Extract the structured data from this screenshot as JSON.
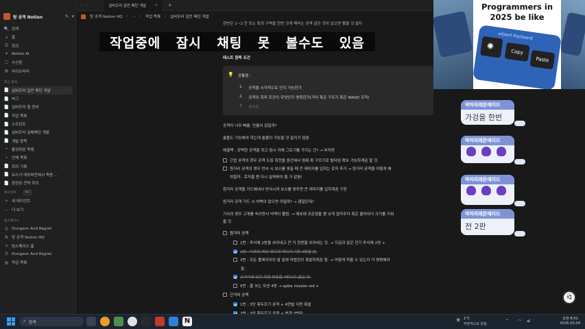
{
  "sidebar": {
    "workspace": "탕 공격 Notion",
    "nav": [
      {
        "icon": "🔍",
        "label": "검색"
      },
      {
        "icon": "⌂",
        "label": "홈"
      },
      {
        "icon": "☰",
        "label": "회의"
      },
      {
        "icon": "✦",
        "label": "Notion AI"
      },
      {
        "icon": "☐",
        "label": "수신함"
      },
      {
        "icon": "▤",
        "label": "라이브러리"
      }
    ],
    "recent_label": "최근 항목",
    "recent": [
      {
        "icon": "📄",
        "label": "실바모라 일반 패턴 개발"
      },
      {
        "icon": "📄",
        "label": "버그"
      },
      {
        "icon": "📄",
        "label": "실바모라 맵 정비"
      },
      {
        "icon": "📄",
        "label": "작업 목록"
      },
      {
        "icon": "📄",
        "label": "스프린트"
      },
      {
        "icon": "📄",
        "label": "실바모라 실베패턴 개발"
      },
      {
        "icon": "📄",
        "label": "개발 항목"
      },
      {
        "icon": "•",
        "label": "활성화된 목록"
      },
      {
        "icon": "•",
        "label": "전체 목록"
      },
      {
        "icon": "📄",
        "label": "회의 기록"
      },
      {
        "icon": "📄",
        "label": "보스가 데모버전에서 죽음 ..."
      },
      {
        "icon": "📄",
        "label": "편관된 전략 회의"
      }
    ],
    "agents_label": "에이전트",
    "agents_badge": "베타",
    "agents": [
      {
        "icon": "+",
        "label": "새 에이전트"
      },
      {
        "icon": "…",
        "label": "더 보기"
      }
    ],
    "teamspace_label": "팀스페이스",
    "teamspace": [
      {
        "icon": "D",
        "label": "Dungeon And Regret"
      },
      {
        "icon": "N",
        "label": "탕 공격 Notion HQ"
      },
      {
        "icon": "⌂",
        "label": "팀스페이스 홈"
      },
      {
        "icon": "D",
        "label": "Dungeon And Regret"
      },
      {
        "icon": "▤",
        "label": "작업 목록"
      }
    ]
  },
  "topbar": {
    "tab_title": "실바모라 일반 패턴 개발",
    "new_tab": "+"
  },
  "breadcrumb": [
    "탕 공격 Notion HQ",
    "...",
    "작업 목록",
    "실바모라 일반 패턴 개발"
  ],
  "overlay_title": [
    "작업중에",
    "잠시",
    "채팅",
    "못",
    "볼수도",
    "있음"
  ],
  "content": {
    "top_cut": "한번은 1~2 칸 또는 특정 구역을 한번 크게 때리는 공격 같은 것이 있으면 좋을 것 같다",
    "test_heading": "테스트 항목 조건",
    "callout": {
      "title": "공통점 :",
      "items": [
        {
          "n": "1.",
          "text": "공격을 시각적으로 인지 가능한가",
          "done": false
        },
        {
          "n": "2.",
          "text": "공격의 회피 조건이 무엇인지 명확한가(거리 혹은 구르기 혹은 WASD 조작)",
          "done": false
        },
        {
          "n": "3.",
          "text": "리스트",
          "done": true
        }
      ]
    },
    "paragraphs": [
      "공격이 너무 빠름. 빈틈이 없달까?",
      "솔플도 가능해야 하는데 솔플이 가능할 것 같지가 않음.",
      "해결책 : 강력한 공격을 하고 잠시 자체 그로기를 가지는 건? → 부자연"
    ],
    "checks1": [
      {
        "checked": false,
        "text": "근접 공격의 경우 공격 도중 회전을 중간에서 멈춰 휙 구르기로 탈타임 확보 가능하게끔 할 것."
      },
      {
        "checked": false,
        "text": "원거리 공격의 경우 반사 시 보스를 맞출 때 큰 데미지를 입히는 로직 추가 → 원거리 공격을 어떻게 해"
      },
      {
        "checked": null,
        "text": "야될까.. 로직을 좀 다시 살펴봐야 될 거 같음!"
      }
    ],
    "para2": [
      "원거리 공격을 가드해내서 반사시켜 보스를 맞추면 큰 데미지를 입히게끔 구현",
      "원거리 공격 가드 시 넉백이 없으면 어떨까? → 괜찮은데?",
      "기사의 경우 고개를 숙이면서 넉백이 풀림. → 애초에 조준점을 좀 낮게 잡아주자 혹은 콜라이더 크기를 키워",
      "줄 것."
    ],
    "ranged_label": "원거리 공격",
    "ranged": [
      {
        "checked": false,
        "text": "1번 : 투사체 2방을 쏘아내고 큰 거 한방을 쏘아내는 것. → 지금과 같은 전기 투사체 2방 +"
      },
      {
        "checked": true,
        "text": "2번 - 타겟의 예상 경로에 레이저 기둥 3방을 쏨.",
        "done": true
      },
      {
        "checked": false,
        "text": "3번 : 모든 플레이어의 발 밑에 마법진이 폭발하게끔 함. → 어떻게 피할 수 있는지 더 명확해야"
      },
      {
        "checked": null,
        "text": "함."
      },
      {
        "checked": true,
        "text": "근거리에 있던 화염 방출을 4번으로 옮길 것.",
        "done": true
      },
      {
        "checked": false,
        "text": "5번 : 홈 쏘는 모션 4방 → spike missile red +"
      }
    ],
    "melee_label": "근거리 공격",
    "melee": [
      {
        "checked": true,
        "text": "1번 : 3단 휘두르기 공격 + 4연발 지면 폭발",
        "done": false
      },
      {
        "checked": true,
        "text": "2번 - 3단 휘두르기 공격 + 번개 3번타",
        "done": false
      }
    ]
  },
  "meme": {
    "caption": "Programmers in 2025 be like",
    "keyboard_label": "eXpert Keyboard",
    "keys": [
      "Copy",
      "Paste"
    ]
  },
  "chat": [
    {
      "name": "악마의레몬에이드",
      "text": "가겅을 한번"
    },
    {
      "name": "악마의레몬에이드",
      "text": ""
    },
    {
      "name": "악마의레몬에이드",
      "text": ""
    },
    {
      "name": "악마의레몬에이드",
      "text": "전 2판"
    }
  ],
  "taskbar": {
    "search": "검색",
    "weather_temp": "1°C",
    "weather_desc": "부분적으로 맑음",
    "time": "오전 8:01",
    "date": "2026-03-04"
  },
  "colors": {
    "accent": "#2d83d6",
    "bubble_header": "#7d93d6",
    "bubble_body": "#eef1fb",
    "emote": "#6a3fc2"
  }
}
